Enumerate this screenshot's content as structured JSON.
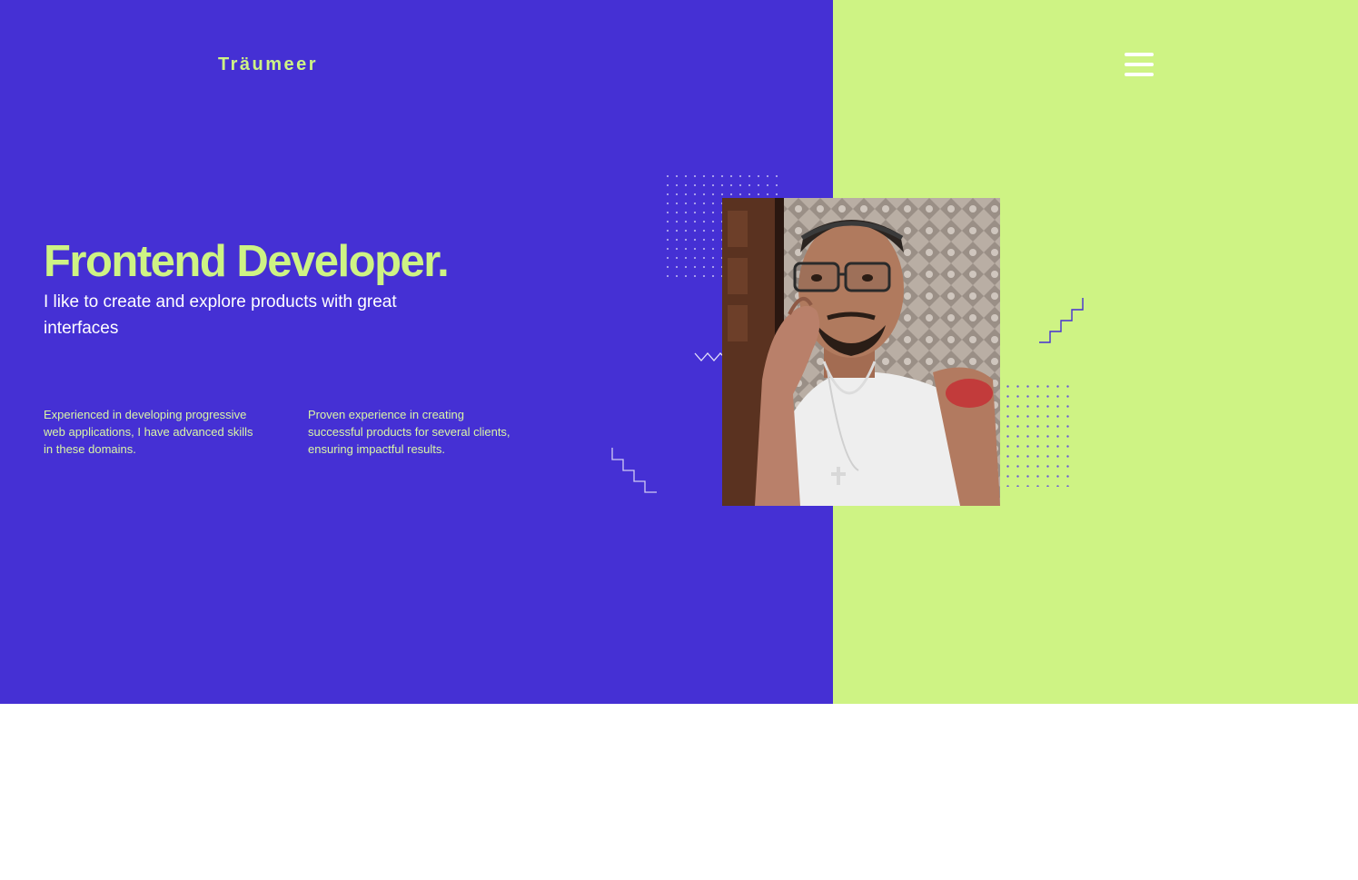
{
  "brand": {
    "name": "Träumeer"
  },
  "header": {
    "menu_icon": "hamburger-menu-icon"
  },
  "hero": {
    "title": "Frontend Developer.",
    "subtitle": "I like to create and explore products with great interfaces",
    "features": [
      {
        "text": "Experienced in developing progressive web applications, I have advanced skills in these domains."
      },
      {
        "text": "Proven experience in creating successful products for several clients, ensuring impactful results."
      }
    ]
  },
  "colors": {
    "primary": "#4530d4",
    "accent": "#cef384",
    "text_light": "#ffffff",
    "background": "#ffffff"
  },
  "decorations": [
    "dot-grid-pattern",
    "zigzag-line",
    "staircase-line"
  ]
}
